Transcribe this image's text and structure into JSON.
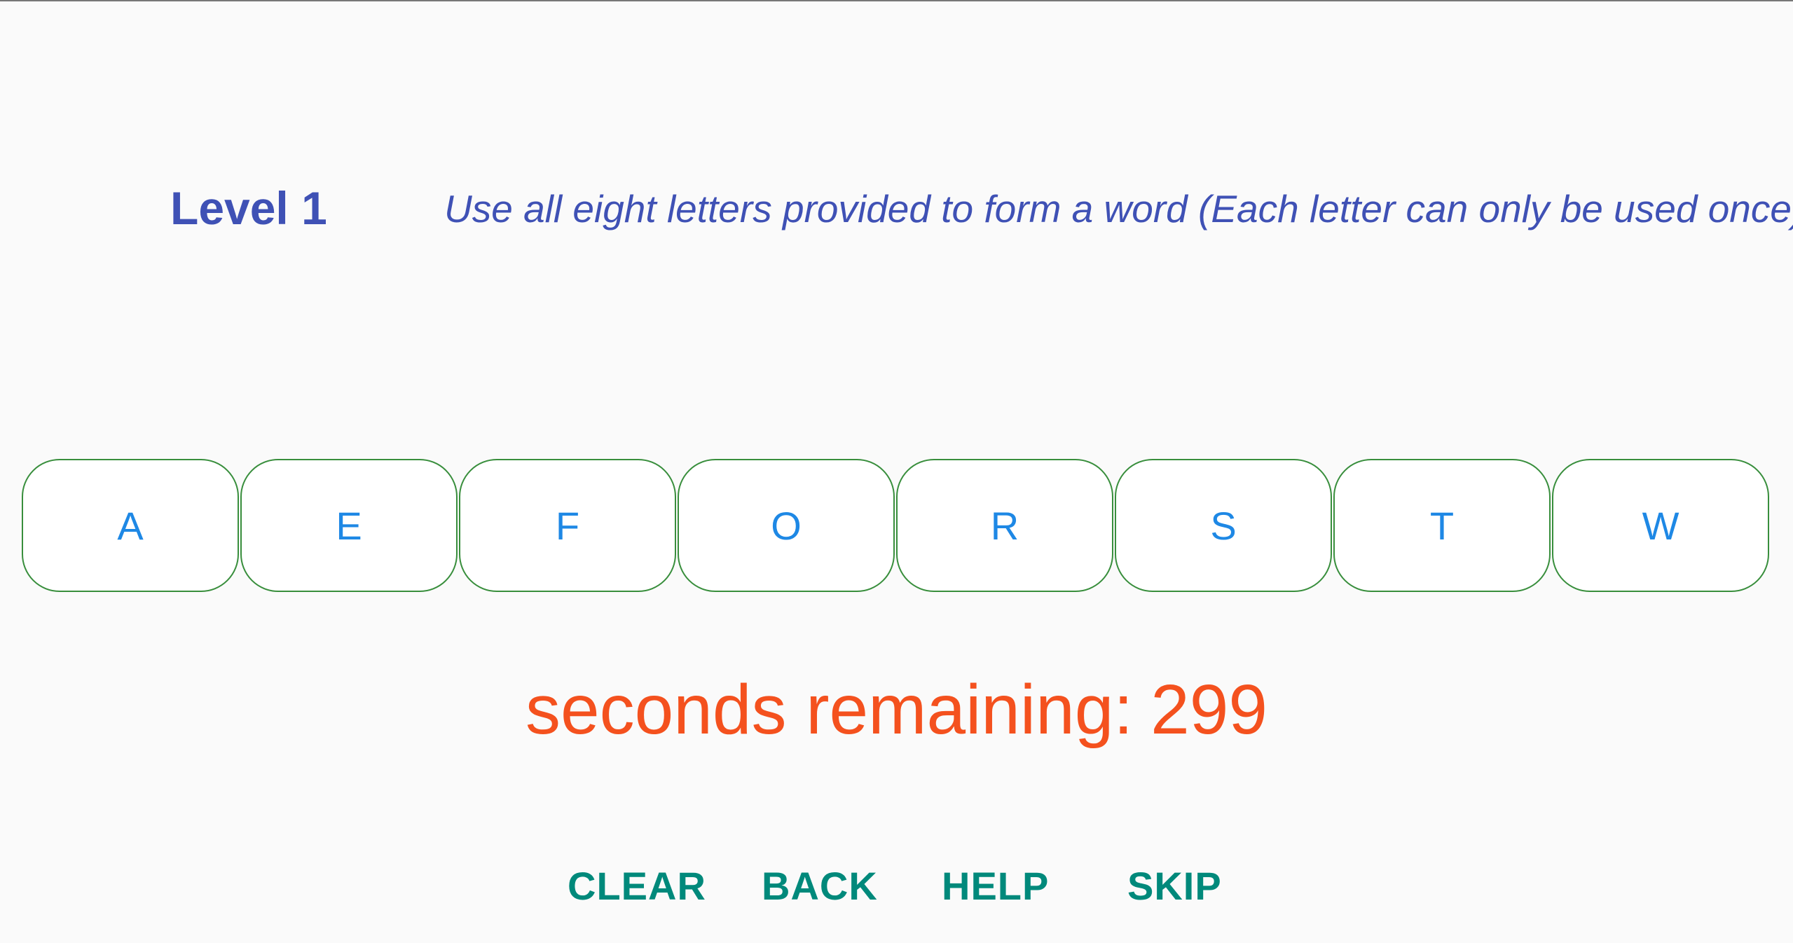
{
  "header": {
    "level_label": "Level 1",
    "instructions": "Use all eight letters provided to form a word (Each letter can only be used once)"
  },
  "tiles": [
    {
      "letter": "A"
    },
    {
      "letter": "E"
    },
    {
      "letter": "F"
    },
    {
      "letter": "O"
    },
    {
      "letter": "R"
    },
    {
      "letter": "S"
    },
    {
      "letter": "T"
    },
    {
      "letter": "W"
    }
  ],
  "timer": {
    "label": "seconds remaining:",
    "seconds": "299"
  },
  "actions": {
    "clear": "CLEAR",
    "back": "BACK",
    "help": "HELP",
    "skip": "SKIP"
  },
  "colors": {
    "title": "#3f51b5",
    "tile_border": "#388e3c",
    "tile_letter": "#1e88e5",
    "timer": "#f4511e",
    "action": "#00897b"
  }
}
